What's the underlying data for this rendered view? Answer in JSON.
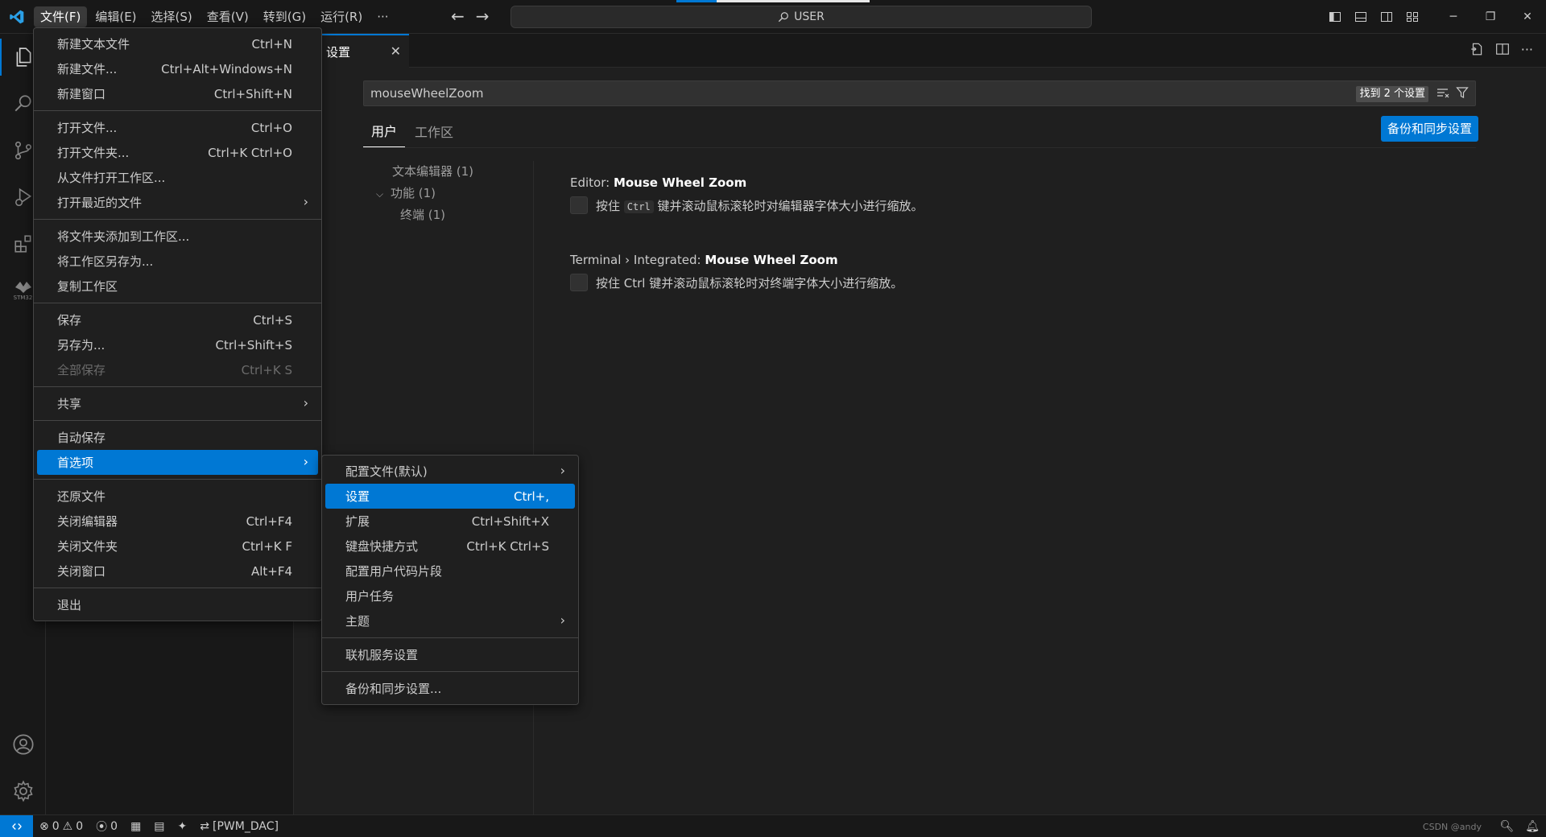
{
  "menubar": {
    "items": [
      "文件(F)",
      "编辑(E)",
      "选择(S)",
      "查看(V)",
      "转到(G)",
      "运行(R)",
      "···"
    ]
  },
  "command_center": {
    "text": "USER"
  },
  "activity_bar": {
    "items": [
      "files-icon",
      "search-icon",
      "source-control-icon",
      "run-debug-icon",
      "extensions-icon",
      "stm32-icon"
    ],
    "stm32_label": "STM32"
  },
  "tabs": [
    {
      "label": "设置"
    }
  ],
  "settings": {
    "search_value": "mouseWheelZoom",
    "result_count": "找到 2 个设置",
    "scopes": [
      "用户",
      "工作区"
    ],
    "backup_button": "备份和同步设置",
    "toc": [
      "文本编辑器 (1)",
      "功能 (1)",
      "终端 (1)"
    ],
    "items": [
      {
        "prefix": "Editor: ",
        "name": "Mouse Wheel Zoom",
        "desc_before": "按住",
        "desc_code": "Ctrl",
        "desc_after": "键并滚动鼠标滚轮时对编辑器字体大小进行缩放。"
      },
      {
        "prefix": "Terminal › Integrated: ",
        "name": "Mouse Wheel Zoom",
        "desc": "按住 Ctrl 键并滚动鼠标滚轮时对终端字体大小进行缩放。"
      }
    ]
  },
  "file_menu": {
    "groups": [
      [
        {
          "label": "新建文本文件",
          "kb": "Ctrl+N"
        },
        {
          "label": "新建文件...",
          "kb": "Ctrl+Alt+Windows+N"
        },
        {
          "label": "新建窗口",
          "kb": "Ctrl+Shift+N"
        }
      ],
      [
        {
          "label": "打开文件...",
          "kb": "Ctrl+O"
        },
        {
          "label": "打开文件夹...",
          "kb": "Ctrl+K Ctrl+O"
        },
        {
          "label": "从文件打开工作区...",
          "kb": ""
        },
        {
          "label": "打开最近的文件",
          "kb": "",
          "submenu": true
        }
      ],
      [
        {
          "label": "将文件夹添加到工作区...",
          "kb": ""
        },
        {
          "label": "将工作区另存为...",
          "kb": ""
        },
        {
          "label": "复制工作区",
          "kb": ""
        }
      ],
      [
        {
          "label": "保存",
          "kb": "Ctrl+S"
        },
        {
          "label": "另存为...",
          "kb": "Ctrl+Shift+S"
        },
        {
          "label": "全部保存",
          "kb": "Ctrl+K S",
          "disabled": true
        }
      ],
      [
        {
          "label": "共享",
          "kb": "",
          "submenu": true
        }
      ],
      [
        {
          "label": "自动保存",
          "kb": ""
        },
        {
          "label": "首选项",
          "kb": "",
          "submenu": true,
          "selected": true
        }
      ],
      [
        {
          "label": "还原文件",
          "kb": ""
        },
        {
          "label": "关闭编辑器",
          "kb": "Ctrl+F4"
        },
        {
          "label": "关闭文件夹",
          "kb": "Ctrl+K F"
        },
        {
          "label": "关闭窗口",
          "kb": "Alt+F4"
        }
      ],
      [
        {
          "label": "退出",
          "kb": ""
        }
      ]
    ]
  },
  "preferences_menu": {
    "groups": [
      [
        {
          "label": "配置文件(默认)",
          "kb": "",
          "submenu": true
        },
        {
          "label": "设置",
          "kb": "Ctrl+,",
          "selected": true
        },
        {
          "label": "扩展",
          "kb": "Ctrl+Shift+X"
        },
        {
          "label": "键盘快捷方式",
          "kb": "Ctrl+K Ctrl+S"
        },
        {
          "label": "配置用户代码片段",
          "kb": ""
        },
        {
          "label": "用户任务",
          "kb": ""
        },
        {
          "label": "主题",
          "kb": "",
          "submenu": true
        }
      ],
      [
        {
          "label": "联机服务设置",
          "kb": ""
        }
      ],
      [
        {
          "label": "备份和同步设置...",
          "kb": ""
        }
      ]
    ]
  },
  "statusbar": {
    "errors": "0",
    "warnings": "0",
    "ports": "0",
    "branch": "[PWM_DAC]",
    "watermark": "CSDN @andy"
  }
}
